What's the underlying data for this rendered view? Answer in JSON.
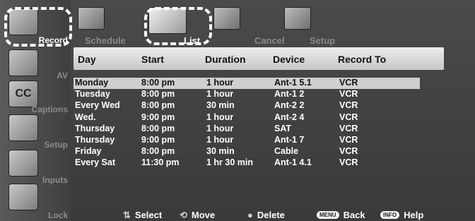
{
  "sidebar": {
    "items": [
      {
        "label": "Record"
      },
      {
        "label": "AV"
      },
      {
        "label": "Captions"
      },
      {
        "label": "Setup"
      },
      {
        "label": "Inputs"
      },
      {
        "label": "Lock"
      }
    ],
    "captions_icon_text": "CC"
  },
  "tabs": [
    {
      "label": "Schedule"
    },
    {
      "label": "List"
    },
    {
      "label": "Cancel"
    },
    {
      "label": "Setup"
    }
  ],
  "table": {
    "headers": [
      "Day",
      "Start",
      "Duration",
      "Device",
      "Record To"
    ],
    "rows": [
      [
        "Monday",
        "8:00 pm",
        "1 hour",
        "Ant-1  5.1",
        "VCR"
      ],
      [
        "Tuesday",
        "8:00 pm",
        "1 hour",
        "Ant-1  2",
        "VCR"
      ],
      [
        "Every Wed",
        "8:00 pm",
        "30 min",
        "Ant-2  2",
        "VCR"
      ],
      [
        "Wed.",
        "9:00 pm",
        "1 hour",
        "Ant-2  4",
        "VCR"
      ],
      [
        "Thursday",
        "8:00 pm",
        "1 hour",
        "SAT",
        "VCR"
      ],
      [
        "Thursday",
        "9:00 pm",
        "1 hour",
        "Ant-1  7",
        "VCR"
      ],
      [
        "Friday",
        "8:00 pm",
        "30 min",
        "Cable",
        "VCR"
      ],
      [
        "Every Sat",
        "11:30 pm",
        "1 hr 30 min",
        "Ant-1  4.1",
        "VCR"
      ]
    ],
    "selected_row": 0
  },
  "footer": {
    "select_label": "Select",
    "move_label": "Move",
    "delete_label": "Delete",
    "menu_key": "MENU",
    "back_label": "Back",
    "info_key": "INFO",
    "help_label": "Help"
  },
  "colors": {
    "background": "#3f3f3f",
    "header_bar": "#d9d9d9",
    "selected_row": "#cfcfcf",
    "highlight_dash": "#ffffff"
  }
}
